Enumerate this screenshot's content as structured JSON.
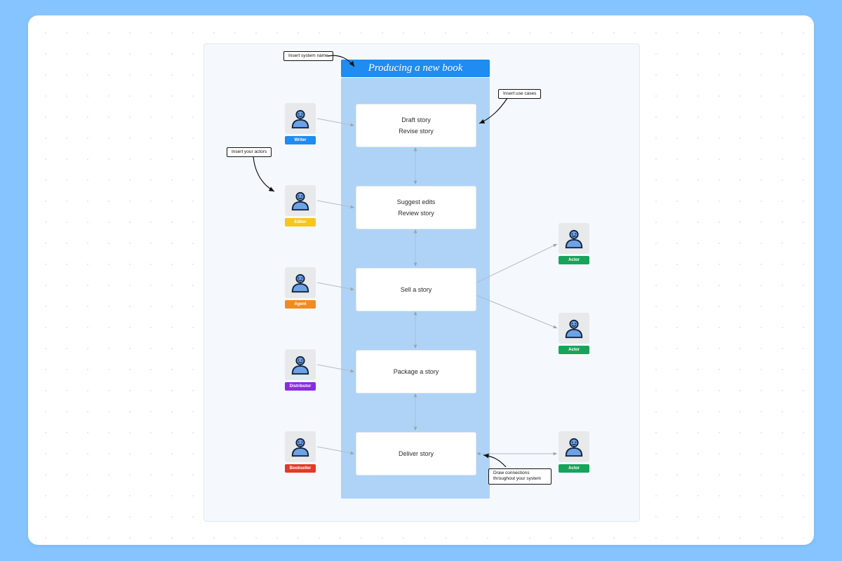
{
  "system": {
    "title": "Producing a new book"
  },
  "usecases": [
    {
      "line1": "Draft story",
      "line2": "Revise story"
    },
    {
      "line1": "Suggest edits",
      "line2": "Review story"
    },
    {
      "line1": "Sell a story",
      "line2": ""
    },
    {
      "line1": "Package a story",
      "line2": ""
    },
    {
      "line1": "Deliver story",
      "line2": ""
    }
  ],
  "left_actors": [
    {
      "label": "Writer",
      "color": "#1e8cf0"
    },
    {
      "label": "Editor",
      "color": "#f8c51b"
    },
    {
      "label": "Agent",
      "color": "#f38b1c"
    },
    {
      "label": "Distributor",
      "color": "#8a2be2"
    },
    {
      "label": "Bookseller",
      "color": "#e53828"
    }
  ],
  "right_actors": [
    {
      "label": "Actor",
      "color": "#18a35a"
    },
    {
      "label": "Actor",
      "color": "#18a35a"
    },
    {
      "label": "Actor",
      "color": "#18a35a"
    }
  ],
  "callouts": {
    "system_name": "Insert system name",
    "actors": "Insert your actors",
    "usecases": "Insert use cases",
    "connections_l1": "Draw connections",
    "connections_l2": "throughout your system"
  }
}
